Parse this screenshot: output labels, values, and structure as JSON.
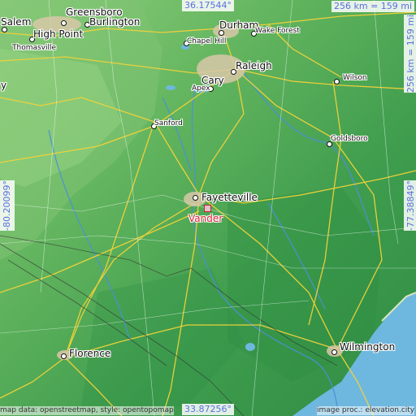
{
  "map": {
    "top_coord": "36.17544°",
    "bottom_coord": "33.87256°",
    "left_coord": "-80.20099°",
    "right_coord": "-77.38849°",
    "scale_horizontal": "256 km = 159 mi",
    "scale_vertical": "256 km = 159 mi",
    "credit_left": "map data: openstreetmap, style: opentopomap",
    "credit_right": "image proc.: elevation.city",
    "target": {
      "name": "Vander",
      "color": "#e0243c"
    },
    "cities": [
      {
        "key": "greensboro",
        "name": "Greensboro",
        "size": "big"
      },
      {
        "key": "salem",
        "name": "Salem",
        "size": "big"
      },
      {
        "key": "burlington",
        "name": "Burlington",
        "size": "big"
      },
      {
        "key": "high_point",
        "name": "High Point",
        "size": "big"
      },
      {
        "key": "thomasville",
        "name": "Thomasville",
        "size": "sm"
      },
      {
        "key": "durham",
        "name": "Durham",
        "size": "big"
      },
      {
        "key": "chapel_hill",
        "name": "Chapel Hill",
        "size": "sm"
      },
      {
        "key": "wake_forest",
        "name": "Wake Forest",
        "size": "sm"
      },
      {
        "key": "raleigh",
        "name": "Raleigh",
        "size": "big"
      },
      {
        "key": "cary",
        "name": "Cary",
        "size": "big"
      },
      {
        "key": "apex",
        "name": "Apex",
        "size": "sm"
      },
      {
        "key": "wilson",
        "name": "Wilson",
        "size": "sm"
      },
      {
        "key": "sanford",
        "name": "Sanford",
        "size": "sm"
      },
      {
        "key": "goldsboro",
        "name": "Goldsboro",
        "size": "sm"
      },
      {
        "key": "fayetteville",
        "name": "Fayetteville",
        "size": "big"
      },
      {
        "key": "wilmington",
        "name": "Wilmington",
        "size": "big"
      },
      {
        "key": "florence",
        "name": "Florence",
        "size": "big"
      },
      {
        "key": "partial_y",
        "name": "y",
        "size": "big"
      }
    ],
    "colors": {
      "lowland": "#3c9c4c",
      "upland": "#7cc474",
      "ocean": "#6eb8e0",
      "road": "#f2d23a",
      "coord_text": "#5a6fe0"
    }
  }
}
